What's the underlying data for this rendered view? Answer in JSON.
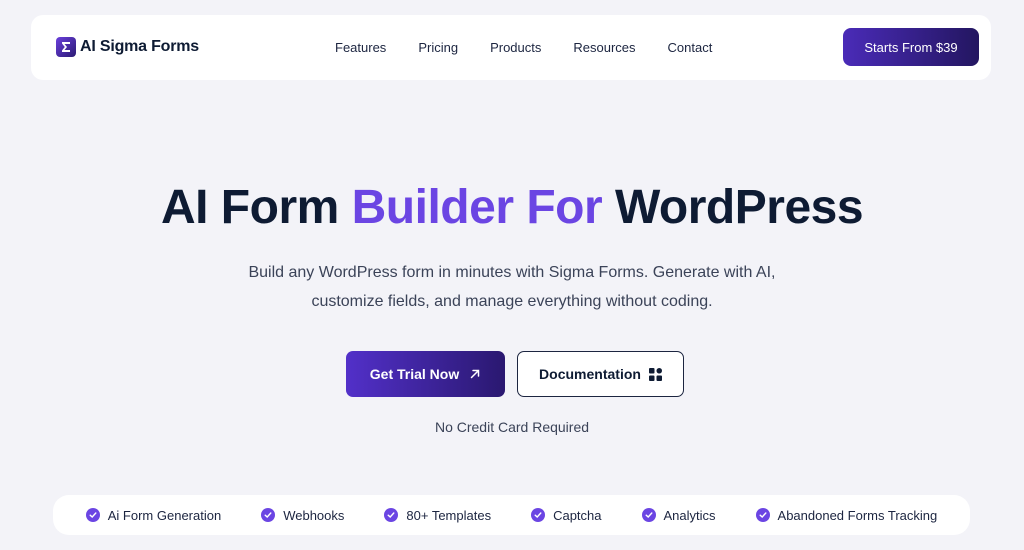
{
  "header": {
    "logo_text": "AI Sigma Forms",
    "logo_icon": "sigma-forms-logo-icon",
    "nav": [
      "Features",
      "Pricing",
      "Products",
      "Resources",
      "Contact"
    ],
    "cta_label": "Starts From $39"
  },
  "hero": {
    "title_part1": "AI Form ",
    "title_accent": "Builder For",
    "title_part2": " WordPress",
    "subtitle_line1": "Build any WordPress form in minutes with Sigma Forms. Generate with AI,",
    "subtitle_line2": "customize fields, and manage everything without coding.",
    "primary_button": "Get Trial Now",
    "primary_icon": "arrow-up-right-icon",
    "secondary_button": "Documentation",
    "secondary_icon": "grid-icon",
    "note": "No Credit Card Required"
  },
  "features": [
    "Ai Form Generation",
    "Webhooks",
    "80+ Templates",
    "Captcha",
    "Analytics",
    "Abandoned Forms Tracking"
  ],
  "colors": {
    "accent": "#6b45e3",
    "dark": "#0e1b33",
    "background": "#f3f3f8"
  }
}
